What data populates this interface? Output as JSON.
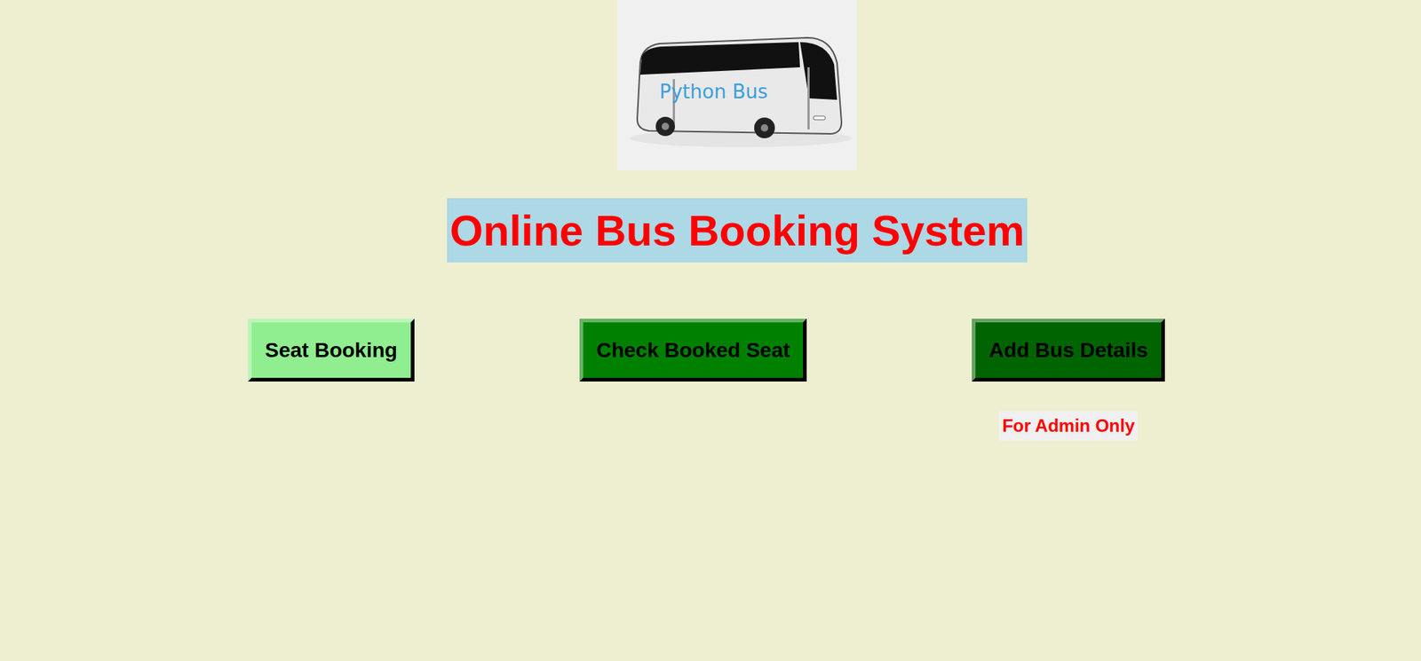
{
  "logo": {
    "text": "Python Bus"
  },
  "title": "Online Bus Booking System",
  "buttons": [
    {
      "label": "Seat Booking",
      "color": "#90ee90"
    },
    {
      "label": "Check Booked Seat",
      "color": "#008000"
    },
    {
      "label": "Add Bus Details",
      "color": "#006400",
      "note": "For Admin Only"
    }
  ]
}
